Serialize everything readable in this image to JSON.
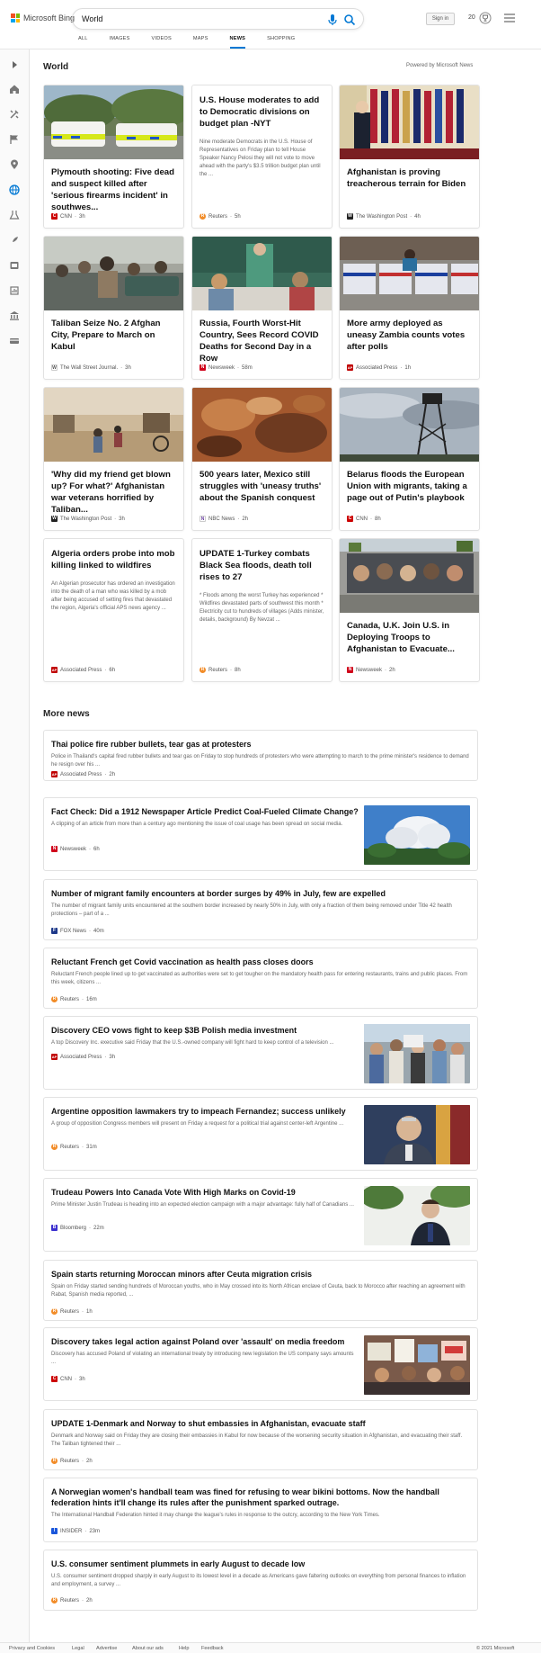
{
  "header": {
    "logo_text": "Microsoft Bing",
    "query": "World",
    "signin_label": "Sign in",
    "points": "20"
  },
  "tabs": [
    "ALL",
    "IMAGES",
    "VIDEOS",
    "MAPS",
    "NEWS",
    "SHOPPING"
  ],
  "active_tab": "NEWS",
  "world": {
    "section_title": "World",
    "powered_by": "Powered by Microsoft News",
    "cards": [
      {
        "title": "Plymouth shooting: Five dead and suspect killed after 'serious firearms incident' in southwes...",
        "snippet": "",
        "source": "CNN",
        "time": "3h",
        "source_color": "#cc0000",
        "source_glyph": "C"
      },
      {
        "title": "U.S. House moderates to add to Democratic divisions on budget plan -NYT",
        "snippet": "Nine moderate Democrats in the U.S. House of Representatives on Friday plan to tell House Speaker Nancy Pelosi they will not vote to move ahead with the party's $3.5 trillion budget plan until the ...",
        "source": "Reuters",
        "time": "5h",
        "source_color": "#f28c28",
        "source_glyph": "R"
      },
      {
        "title": "Afghanistan is proving treacherous terrain for Biden",
        "snippet": "",
        "source": "The Washington Post",
        "time": "4h",
        "source_color": "#222222",
        "source_glyph": "W"
      },
      {
        "title": "Taliban Seize No. 2 Afghan City, Prepare to March on Kabul",
        "snippet": "",
        "source": "The Wall Street Journal.",
        "time": "3h",
        "source_color": "#555555",
        "source_glyph": "W"
      },
      {
        "title": "Russia, Fourth Worst-Hit Country, Sees Record COVID Deaths for Second Day in a Row",
        "snippet": "",
        "source": "Newsweek",
        "time": "58m",
        "source_color": "#d0021b",
        "source_glyph": "N"
      },
      {
        "title": "More army deployed as uneasy Zambia counts votes after polls",
        "snippet": "",
        "source": "Associated Press",
        "time": "1h",
        "source_color": "#c00000",
        "source_glyph": "AP"
      },
      {
        "title": "'Why did my friend get blown up? For what?' Afghanistan war veterans horrified by Taliban...",
        "snippet": "",
        "source": "The Washington Post",
        "time": "3h",
        "source_color": "#222222",
        "source_glyph": "W"
      },
      {
        "title": "500 years later, Mexico still struggles with 'uneasy truths' about the Spanish conquest",
        "snippet": "",
        "source": "NBC News",
        "time": "2h",
        "source_color": "#6a3fa0",
        "source_glyph": "N"
      },
      {
        "title": "Belarus floods the European Union with migrants, taking a page out of Putin's playbook",
        "snippet": "",
        "source": "CNN",
        "time": "8h",
        "source_color": "#cc0000",
        "source_glyph": "C"
      },
      {
        "title": "Algeria orders probe into mob killing linked to wildfires",
        "snippet": "An Algerian prosecutor has ordered an investigation into the death of a man who was killed by a mob after being accused of setting fires that devastated the region, Algeria's official APS news agency ...",
        "source": "Associated Press",
        "time": "6h",
        "source_color": "#c00000",
        "source_glyph": "AP"
      },
      {
        "title": "UPDATE 1-Turkey combats Black Sea floods, death toll rises to 27",
        "snippet": "* Floods among the worst Turkey has experienced * Wildfires devastated parts of southwest this month * Electricity cut to hundreds of villages (Adds minister, details, background) By Nevzat ...",
        "source": "Reuters",
        "time": "8h",
        "source_color": "#f28c28",
        "source_glyph": "R"
      },
      {
        "title": "Canada, U.K. Join U.S. in Deploying Troops to Afghanistan to Evacuate...",
        "snippet": "",
        "source": "Newsweek",
        "time": "2h",
        "source_color": "#d0021b",
        "source_glyph": "N"
      }
    ]
  },
  "more_news": {
    "section_title": "More news",
    "items": [
      {
        "title": "Thai police fire rubber bullets, tear gas at protesters",
        "snippet": "Police in Thailand's capital fired rubber bullets and tear gas on Friday to stop hundreds of protesters who were attempting to march to the prime minister's residence to demand he resign over his ...",
        "source": "Associated Press",
        "time": "2h",
        "source_color": "#c00000",
        "source_glyph": "AP"
      },
      {
        "title": "Fact Check: Did a 1912 Newspaper Article Predict Coal-Fueled Climate Change?",
        "snippet": "A clipping of an article from more than a century ago mentioning the issue of coal usage has been spread on social media.",
        "source": "Newsweek",
        "time": "6h",
        "source_color": "#d0021b",
        "source_glyph": "N"
      },
      {
        "title": "Number of migrant family encounters at border surges by 49% in July, few are expelled",
        "snippet": "The number of migrant family units encountered at the southern border increased by nearly 50% in July, with only a fraction of them being removed under Title 42 health protections – part of a ...",
        "source": "FOX News",
        "time": "40m",
        "source_color": "#1f3a8a",
        "source_glyph": "F"
      },
      {
        "title": "Reluctant French get Covid vaccination as health pass closes doors",
        "snippet": "Reluctant French people lined up to get vaccinated as authorities were set to get tougher on the mandatory health pass for entering restaurants, trains and public places. From this week, citizens ...",
        "source": "Reuters",
        "time": "16m",
        "source_color": "#f28c28",
        "source_glyph": "R"
      },
      {
        "title": "Discovery CEO vows fight to keep $3B Polish media investment",
        "snippet": "A top Discovery Inc. executive said Friday that the U.S.-owned company will fight hard to keep control of a television ...",
        "source": "Associated Press",
        "time": "3h",
        "source_color": "#c00000",
        "source_glyph": "AP"
      },
      {
        "title": "Argentine opposition lawmakers try to impeach Fernandez; success unlikely",
        "snippet": "A group of opposition Congress members will present on Friday a request for a political trial against center-left Argentine ...",
        "source": "Reuters",
        "time": "31m",
        "source_color": "#f28c28",
        "source_glyph": "R"
      },
      {
        "title": "Trudeau Powers Into Canada Vote With High Marks on Covid-19",
        "snippet": "Prime Minister Justin Trudeau is heading into an expected election campaign with a major advantage: fully half of Canadians ...",
        "source": "Bloomberg",
        "time": "22m",
        "source_color": "#3b2fcf",
        "source_glyph": "B"
      },
      {
        "title": "Spain starts returning Moroccan minors after Ceuta migration crisis",
        "snippet": "Spain on Friday started sending hundreds of Moroccan youths, who in May crossed into its North African enclave of Ceuta, back to Morocco after reaching an agreement with Rabat, Spanish media reported, ...",
        "source": "Reuters",
        "time": "1h",
        "source_color": "#f28c28",
        "source_glyph": "R"
      },
      {
        "title": "Discovery takes legal action against Poland over 'assault' on media freedom",
        "snippet": "Discovery has accused Poland of violating an international treaty by introducing new legislation the US company says amounts ...",
        "source": "CNN",
        "time": "3h",
        "source_color": "#cc0000",
        "source_glyph": "C"
      },
      {
        "title": "UPDATE 1-Denmark and Norway to shut embassies in Afghanistan, evacuate staff",
        "snippet": "Denmark and Norway said on Friday they are closing their embassies in Kabul for now because of the worsening security situation in Afghanistan, and evacuating their staff. The Taliban tightened their ...",
        "source": "Reuters",
        "time": "2h",
        "source_color": "#f28c28",
        "source_glyph": "R"
      },
      {
        "title": "A Norwegian women's handball team was fined for refusing to wear bikini bottoms. Now the handball federation hints it'll change its rules after the punishment sparked outrage.",
        "snippet": "The International Handball Federation hinted it may change the league's rules in response to the outcry, according to the New York Times.",
        "source": "INSIDER",
        "time": "23m",
        "source_color": "#1a56db",
        "source_glyph": "I"
      },
      {
        "title": "U.S. consumer sentiment plummets in early August to decade low",
        "snippet": "U.S. consumer sentiment dropped sharply in early August to its lowest level in a decade as Americans gave faltering outlooks on everything from personal finances to inflation and employment, a survey ...",
        "source": "Reuters",
        "time": "2h",
        "source_color": "#f28c28",
        "source_glyph": "R"
      }
    ]
  },
  "footer": {
    "links": [
      "Privacy and Cookies",
      "Legal",
      "Advertise",
      "About our ads",
      "Help",
      "Feedback"
    ],
    "copyright": "© 2021 Microsoft"
  },
  "icons": {
    "rail": [
      "expand-arrow-icon",
      "home-icon",
      "tools-icon",
      "flag-icon",
      "location-pin-icon",
      "globe-icon",
      "science-icon",
      "rocket-icon",
      "entertainment-icon",
      "finance-icon",
      "bank-icon",
      "card-icon"
    ]
  }
}
